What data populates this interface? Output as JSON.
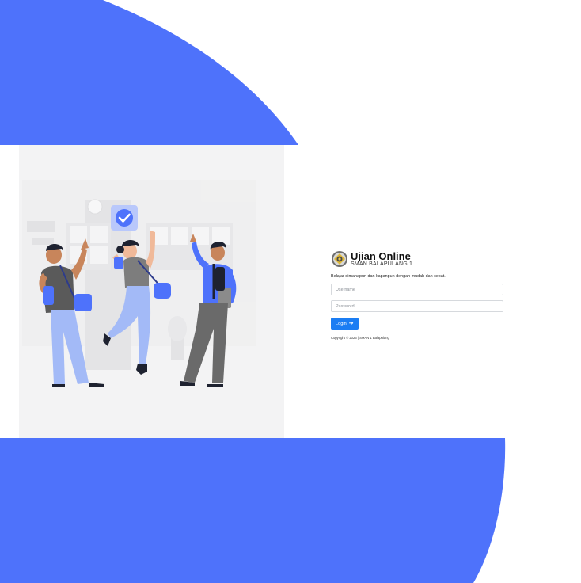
{
  "brand": {
    "app_title": "Ujian Online",
    "school_name": "SMAN BALAPULANG 1",
    "logo_icon": "school-emblem-icon"
  },
  "login": {
    "tagline": "Belajar dimanapun dan kapanpun dengan mudah dan cepat.",
    "username_placeholder": "Username",
    "password_placeholder": "Password",
    "button_label": "Login",
    "button_icon": "arrow-right-icon",
    "copyright": "Copyright © 2023 | SMAN 1 Balapulang"
  },
  "illustration": {
    "subject": "students-celebrating-illustration",
    "check_icon": "checkmark-icon"
  },
  "colors": {
    "accent_blue": "#4e72fb",
    "button_blue": "#1b7df3",
    "panel_gray": "#f3f3f4"
  }
}
